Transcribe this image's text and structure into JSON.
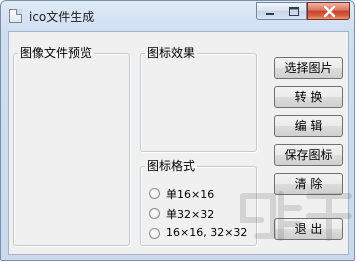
{
  "window": {
    "title": "ico文件生成"
  },
  "groups": {
    "preview_label": "图像文件预览",
    "effect_label": "图标效果",
    "format_label": "图标格式"
  },
  "format_options": [
    {
      "label": "单16×16",
      "selected": false
    },
    {
      "label": "单32×32",
      "selected": false
    },
    {
      "label": "16×16, 32×32",
      "selected": false
    }
  ],
  "buttons": {
    "select_image": "选择图片",
    "convert": "转 换",
    "edit": "编 辑",
    "save_icon": "保存图标",
    "clear": "清 除",
    "exit": "退 出"
  },
  "icons": {
    "app": "document-icon",
    "minimize": "minimize-icon",
    "maximize": "maximize-icon",
    "close": "close-icon"
  }
}
